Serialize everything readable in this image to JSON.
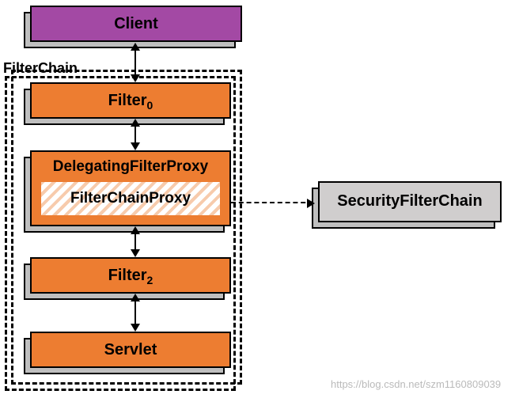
{
  "client": "Client",
  "chain_label": "FilterChain",
  "filter0_base": "Filter",
  "filter0_sub": "0",
  "delegating": "DelegatingFilterProxy",
  "fcp": "FilterChainProxy",
  "filter2_base": "Filter",
  "filter2_sub": "2",
  "servlet": "Servlet",
  "security_chain": "SecurityFilterChain",
  "watermark": "https://blog.csdn.net/szm1160809039"
}
